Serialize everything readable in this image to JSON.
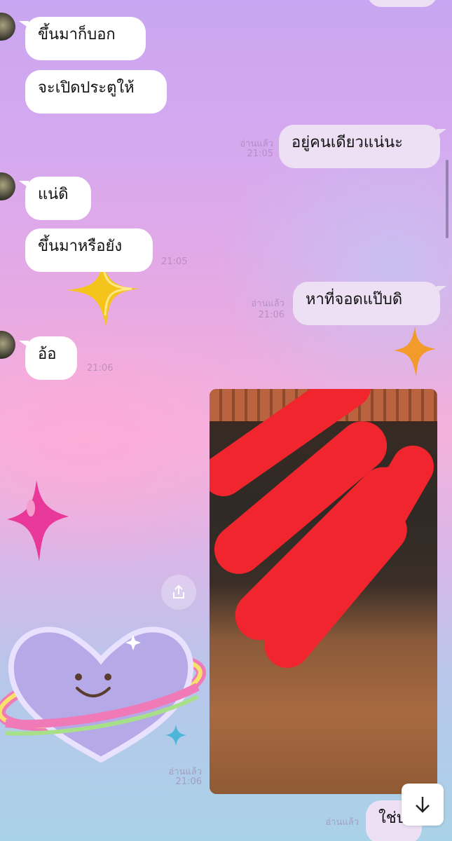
{
  "chat": {
    "incoming": [
      {
        "text": "ขึ้นมาก็บอก"
      },
      {
        "text": "จะเปิดประตูให้"
      },
      {
        "text": "แน่ดิ"
      },
      {
        "text": "ขึ้นมาหรือยัง",
        "time": "21:05"
      },
      {
        "text": "อ้อ",
        "time": "21:06"
      }
    ],
    "outgoing": [
      {
        "text": "อยู่คนเดียวแน่นะ",
        "read": "อ่านแล้ว",
        "time": "21:05"
      },
      {
        "text": "หาที่จอดแป๊บดิ",
        "read": "อ่านแล้ว",
        "time": "21:06"
      },
      {
        "read": "อ่านแล้ว",
        "time": "21:06"
      },
      {
        "text": "ใช่ปะ",
        "read": "อ่านแล้ว"
      }
    ]
  },
  "icons": {
    "share": "share-icon",
    "scroll_down": "arrow-down-icon"
  },
  "colors": {
    "bubble_in": "#ffffff",
    "bubble_out": "#ede0f4",
    "redaction": "#f0252e"
  }
}
